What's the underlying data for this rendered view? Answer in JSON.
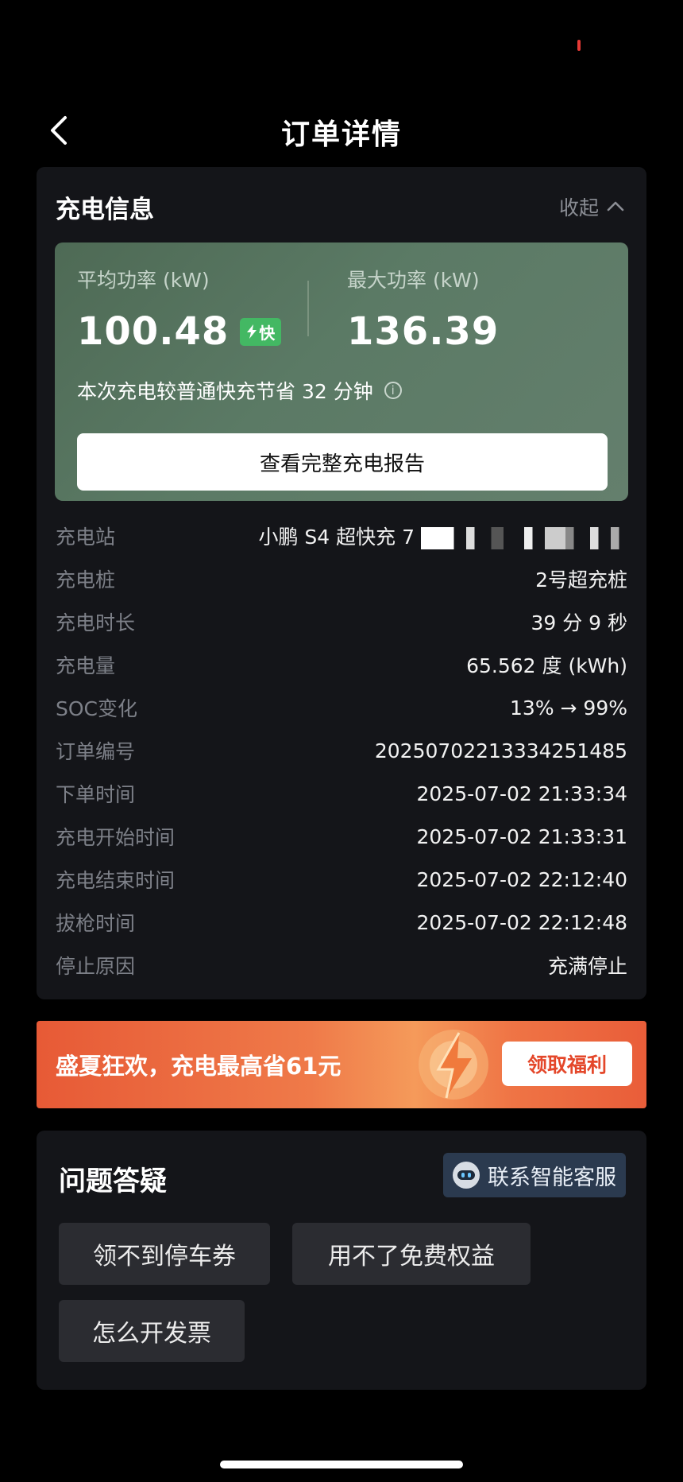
{
  "nav": {
    "title": "订单详情"
  },
  "charge_info": {
    "title": "充电信息",
    "collapse_label": "收起",
    "avg_power": {
      "label": "平均功率 (kW)",
      "value": "100.48",
      "badge": "快"
    },
    "max_power": {
      "label": "最大功率 (kW)",
      "value": "136.39"
    },
    "saving_text": "本次充电较普通快充节省 32 分钟",
    "report_button": "查看完整充电报告",
    "rows": [
      {
        "label": "充电站",
        "value": "小鹏 S4 超快充 7"
      },
      {
        "label": "充电桩",
        "value": "2号超充桩"
      },
      {
        "label": "充电时长",
        "value": "39 分 9 秒"
      },
      {
        "label": "充电量",
        "value": "65.562 度 (kWh)"
      },
      {
        "label": "SOC变化",
        "value": "13% → 99%"
      },
      {
        "label": "订单编号",
        "value": "20250702213334251485"
      },
      {
        "label": "下单时间",
        "value": "2025-07-02 21:33:34"
      },
      {
        "label": "充电开始时间",
        "value": "2025-07-02 21:33:31"
      },
      {
        "label": "充电结束时间",
        "value": "2025-07-02 22:12:40"
      },
      {
        "label": "拔枪时间",
        "value": "2025-07-02 22:12:48"
      },
      {
        "label": "停止原因",
        "value": "充满停止"
      }
    ]
  },
  "promo": {
    "text": "盛夏狂欢，充电最高省61元",
    "button": "领取福利"
  },
  "faq": {
    "title": "问题答疑",
    "service_button": "联系智能客服",
    "chips": [
      "领不到停车券",
      "用不了免费权益",
      "怎么开发票"
    ]
  },
  "colors": {
    "accent_green": "#43b863",
    "promo_orange": "#e75a36",
    "status_red": "#e53935"
  },
  "icons": {
    "back": "chevron-left-icon",
    "collapse": "chevron-up-icon",
    "info": "info-icon",
    "bolt": "bolt-icon",
    "robot": "robot-icon"
  }
}
